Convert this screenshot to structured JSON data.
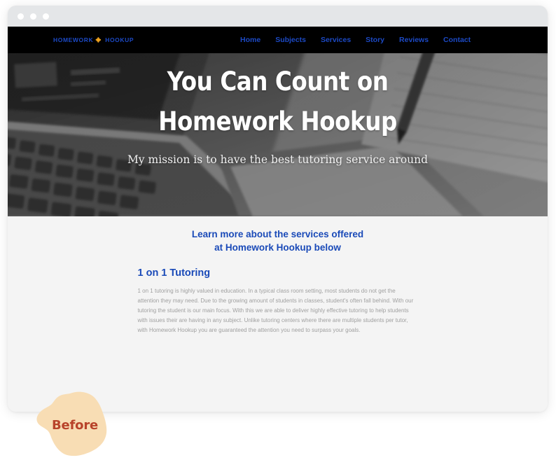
{
  "browser": {
    "dots": [
      "close-dot",
      "minimize-dot",
      "maximize-dot"
    ]
  },
  "site": {
    "logo": {
      "text_left": "HOMEWORK",
      "text_right": "HOOKUP",
      "icon": "puzzle-piece-icon",
      "text_color": "#1c49c4",
      "icon_color": "#f0a31e"
    },
    "nav": {
      "items": [
        {
          "label": "Home"
        },
        {
          "label": "Subjects"
        },
        {
          "label": "Services"
        },
        {
          "label": "Story"
        },
        {
          "label": "Reviews"
        },
        {
          "label": "Contact"
        }
      ],
      "link_color": "#1c49c4",
      "background": "#000000"
    },
    "hero": {
      "title_line1": "You Can Count on",
      "title_line2": "Homework Hookup",
      "subtitle": "My mission is to have the best tutoring service around",
      "image_description": "grayscale photo of laptop keyboard, notebook and pen",
      "title_color": "#ffffff"
    },
    "content": {
      "section_heading_line1": "Learn more about the services offered",
      "section_heading_line2": "at Homework Hookup below",
      "heading_color": "#1a4ab8",
      "article": {
        "title": "1 on 1 Tutoring",
        "body": "1 on 1 tutoring is highly valued in education. In a typical class room setting, most students do not get the attention they may need. Due to the growing amount of students in classes, student's often fall behind. With our tutoring the student is our main focus. With this we are able to deliver highly effective tutoring to help students with issues their are having in any subject. Unlike tutoring centers where there are multiple students per tutor, with Homework Hookup you are guaranteed the attention you need to surpass your goals."
      }
    }
  },
  "annotation": {
    "badge_label": "Before",
    "badge_text_color": "#b8432a",
    "badge_fill_color": "#f8ddb4"
  }
}
